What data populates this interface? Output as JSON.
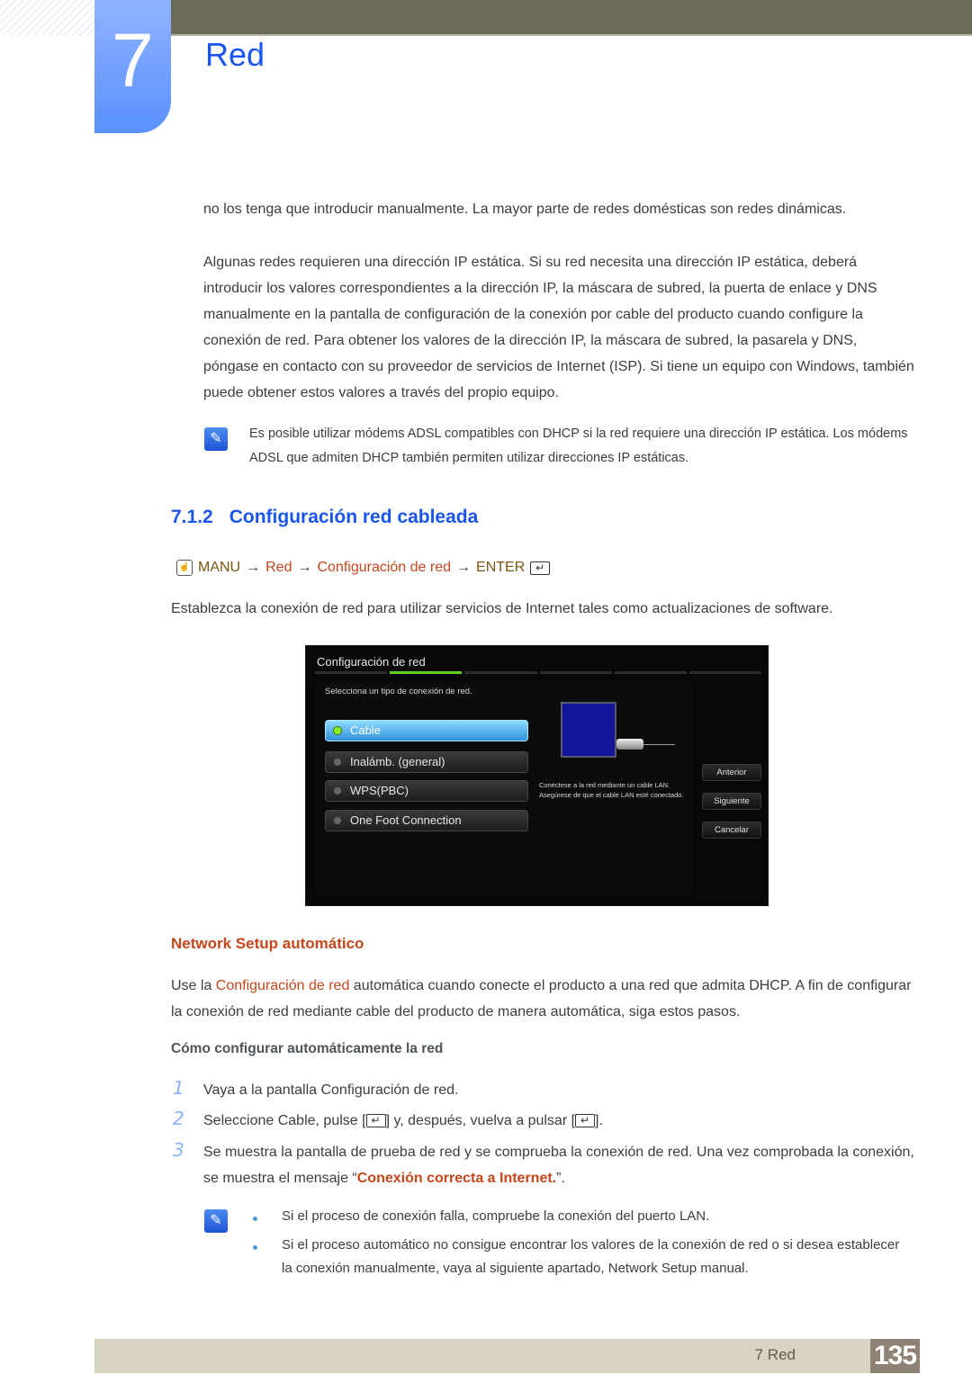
{
  "chapter": {
    "number": "7",
    "title": "Red"
  },
  "intro_paragraphs": [
    "no los tenga que introducir manualmente. La mayor parte de redes domésticas son redes dinámicas.",
    "Algunas redes requieren una dirección IP estática. Si su red necesita una dirección IP estática, deberá introducir los valores correspondientes a la dirección IP, la máscara de subred, la puerta de enlace y DNS manualmente en la pantalla de configuración de la conexión por cable del producto cuando configure la conexión de red. Para obtener los valores de la dirección IP, la máscara de subred, la pasarela y DNS, póngase en contacto con su proveedor de servicios de Internet (ISP). Si tiene un equipo con Windows, también puede obtener estos valores a través del propio equipo."
  ],
  "note1": "Es posible utilizar módems ADSL compatibles con DHCP si la red requiere una dirección IP estática. Los módems ADSL que admiten DHCP también permiten utilizar direcciones IP estáticas.",
  "section": {
    "number": "7.1.2",
    "title": "Configuración red cableada"
  },
  "menu_path": {
    "menu": "MANU",
    "arrow": "→",
    "item1": "Red",
    "item2": "Configuración de red",
    "item3": "ENTER",
    "menu_icon": "☝",
    "enter_icon": "↵"
  },
  "section_desc": "Establezca la conexión de red para utilizar servicios de Internet tales como actualizaciones de software.",
  "tv_screen": {
    "title": "Configuración de red",
    "active_step": 2,
    "subtitle": "Selecciona un tipo de conexión de red.",
    "options": [
      {
        "label": "Cable",
        "selected": true
      },
      {
        "label": "Inalámb. (general)",
        "selected": false
      },
      {
        "label": "WPS(PBC)",
        "selected": false
      },
      {
        "label": "One Foot Connection",
        "selected": false
      }
    ],
    "description": "Conéctese a la red mediante un cable LAN. Asegúrese de que el cable LAN esté conectado.",
    "buttons": {
      "back": "Anterior",
      "next": "Siguiente",
      "cancel": "Cancelar"
    }
  },
  "auto_setup": {
    "title": "Network Setup automático",
    "p_before": "Use la ",
    "p_highlight": "Configuración de red",
    "p_after": " automática cuando conecte el producto a una red que admita DHCP. A fin de configurar la conexión de red mediante cable del producto de manera automática, siga estos pasos.",
    "how_to_title": "Cómo configurar automáticamente la red",
    "steps": [
      {
        "num": "1",
        "text": "Vaya a la pantalla Configuración de red."
      },
      {
        "num": "2",
        "text_a": "Seleccione Cable, pulse [",
        "text_b": "] y, después, vuelva a pulsar [",
        "text_c": "]."
      },
      {
        "num": "3",
        "text_a": "Se muestra la pantalla de prueba de red y se comprueba la conexión de red. Una vez comprobada la conexión, se muestra el mensaje “",
        "highlight": "Conexión correcta a Internet.",
        "text_c": "”."
      }
    ],
    "notes": [
      "Si el proceso de conexión falla, compruebe la conexión del puerto LAN.",
      "Si el proceso automático no consigue encontrar los valores de la conexión de red o si desea establecer la conexión manualmente, vaya al siguiente apartado, Network Setup manual."
    ]
  },
  "footer": {
    "label": "7 Red",
    "page": "135"
  },
  "colors": {
    "accent_blue": "#1a55f0",
    "accent_orange": "#c8461b",
    "menu_brown": "#7a5510",
    "tv_active_step": "#5ad023"
  }
}
